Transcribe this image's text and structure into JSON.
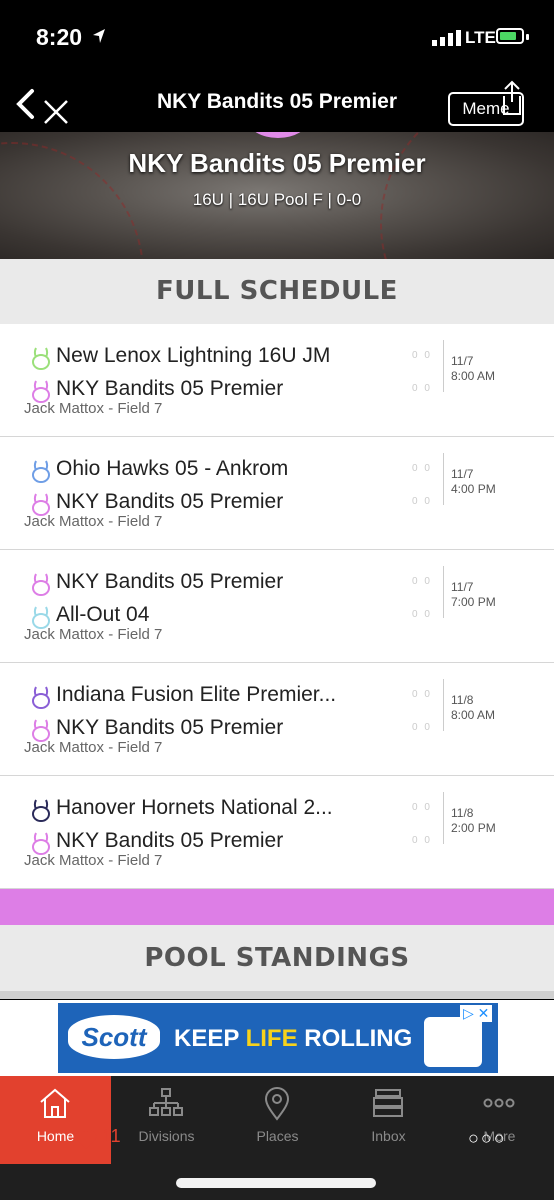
{
  "status_bar": {
    "time": "8:20",
    "network": "LTE"
  },
  "nav": {
    "title": "NKY Bandits 05 Premier",
    "meme_label": "Meme"
  },
  "hero": {
    "team_name": "NKY Bandits 05 Premier",
    "subtitle": "16U | 16U Pool F | 0-0"
  },
  "schedule": {
    "header": "FULL SCHEDULE",
    "games": [
      {
        "team1": "New Lenox Lightning 16U JM",
        "team1_color": "#9be07a",
        "team2": "NKY Bandits 05 Premier",
        "team2_color": "#dd7ee6",
        "location": "Jack Mattox - Field 7",
        "date": "11/7",
        "time": "8:00 AM",
        "score1": "0 0",
        "score2": "0 0"
      },
      {
        "team1": "Ohio Hawks 05 - Ankrom",
        "team1_color": "#6f9ee6",
        "team2": "NKY Bandits 05 Premier",
        "team2_color": "#dd7ee6",
        "location": "Jack Mattox - Field 7",
        "date": "11/7",
        "time": "4:00 PM",
        "score1": "0 0",
        "score2": "0 0"
      },
      {
        "team1": "NKY Bandits 05 Premier",
        "team1_color": "#dd7ee6",
        "team2": "All-Out 04",
        "team2_color": "#9ad9e8",
        "location": "Jack Mattox - Field 7",
        "date": "11/7",
        "time": "7:00 PM",
        "score1": "0 0",
        "score2": "0 0"
      },
      {
        "team1": "Indiana Fusion Elite Premier...",
        "team1_color": "#8a5fd6",
        "team2": "NKY Bandits 05 Premier",
        "team2_color": "#dd7ee6",
        "location": "Jack Mattox - Field 7",
        "date": "11/8",
        "time": "8:00 AM",
        "score1": "0 0",
        "score2": "0 0"
      },
      {
        "team1": "Hanover Hornets National 2...",
        "team1_color": "#2b2b5a",
        "team2": "NKY Bandits 05 Premier",
        "team2_color": "#dd7ee6",
        "location": "Jack Mattox - Field 7",
        "date": "11/8",
        "time": "2:00 PM",
        "score1": "0 0",
        "score2": "0 0"
      }
    ]
  },
  "standings": {
    "header": "POOL STANDINGS"
  },
  "ad": {
    "brand": "Scott",
    "slogan_prefix": "KEEP ",
    "slogan_highlight": "LIFE",
    "slogan_suffix": " ROLLING"
  },
  "tabbar": {
    "tabs": [
      {
        "label": "Home",
        "icon": "home-icon"
      },
      {
        "label": "Divisions",
        "icon": "hierarchy-icon"
      },
      {
        "label": "Places",
        "icon": "location-pin-icon"
      },
      {
        "label": "Inbox",
        "icon": "inbox-icon"
      },
      {
        "label": "More",
        "icon": "more-icon"
      }
    ],
    "likes_count": "11"
  },
  "colors": {
    "accent": "#e2412e",
    "team": "#dd7ee6",
    "tabbar_bg": "#1f1f1f"
  }
}
